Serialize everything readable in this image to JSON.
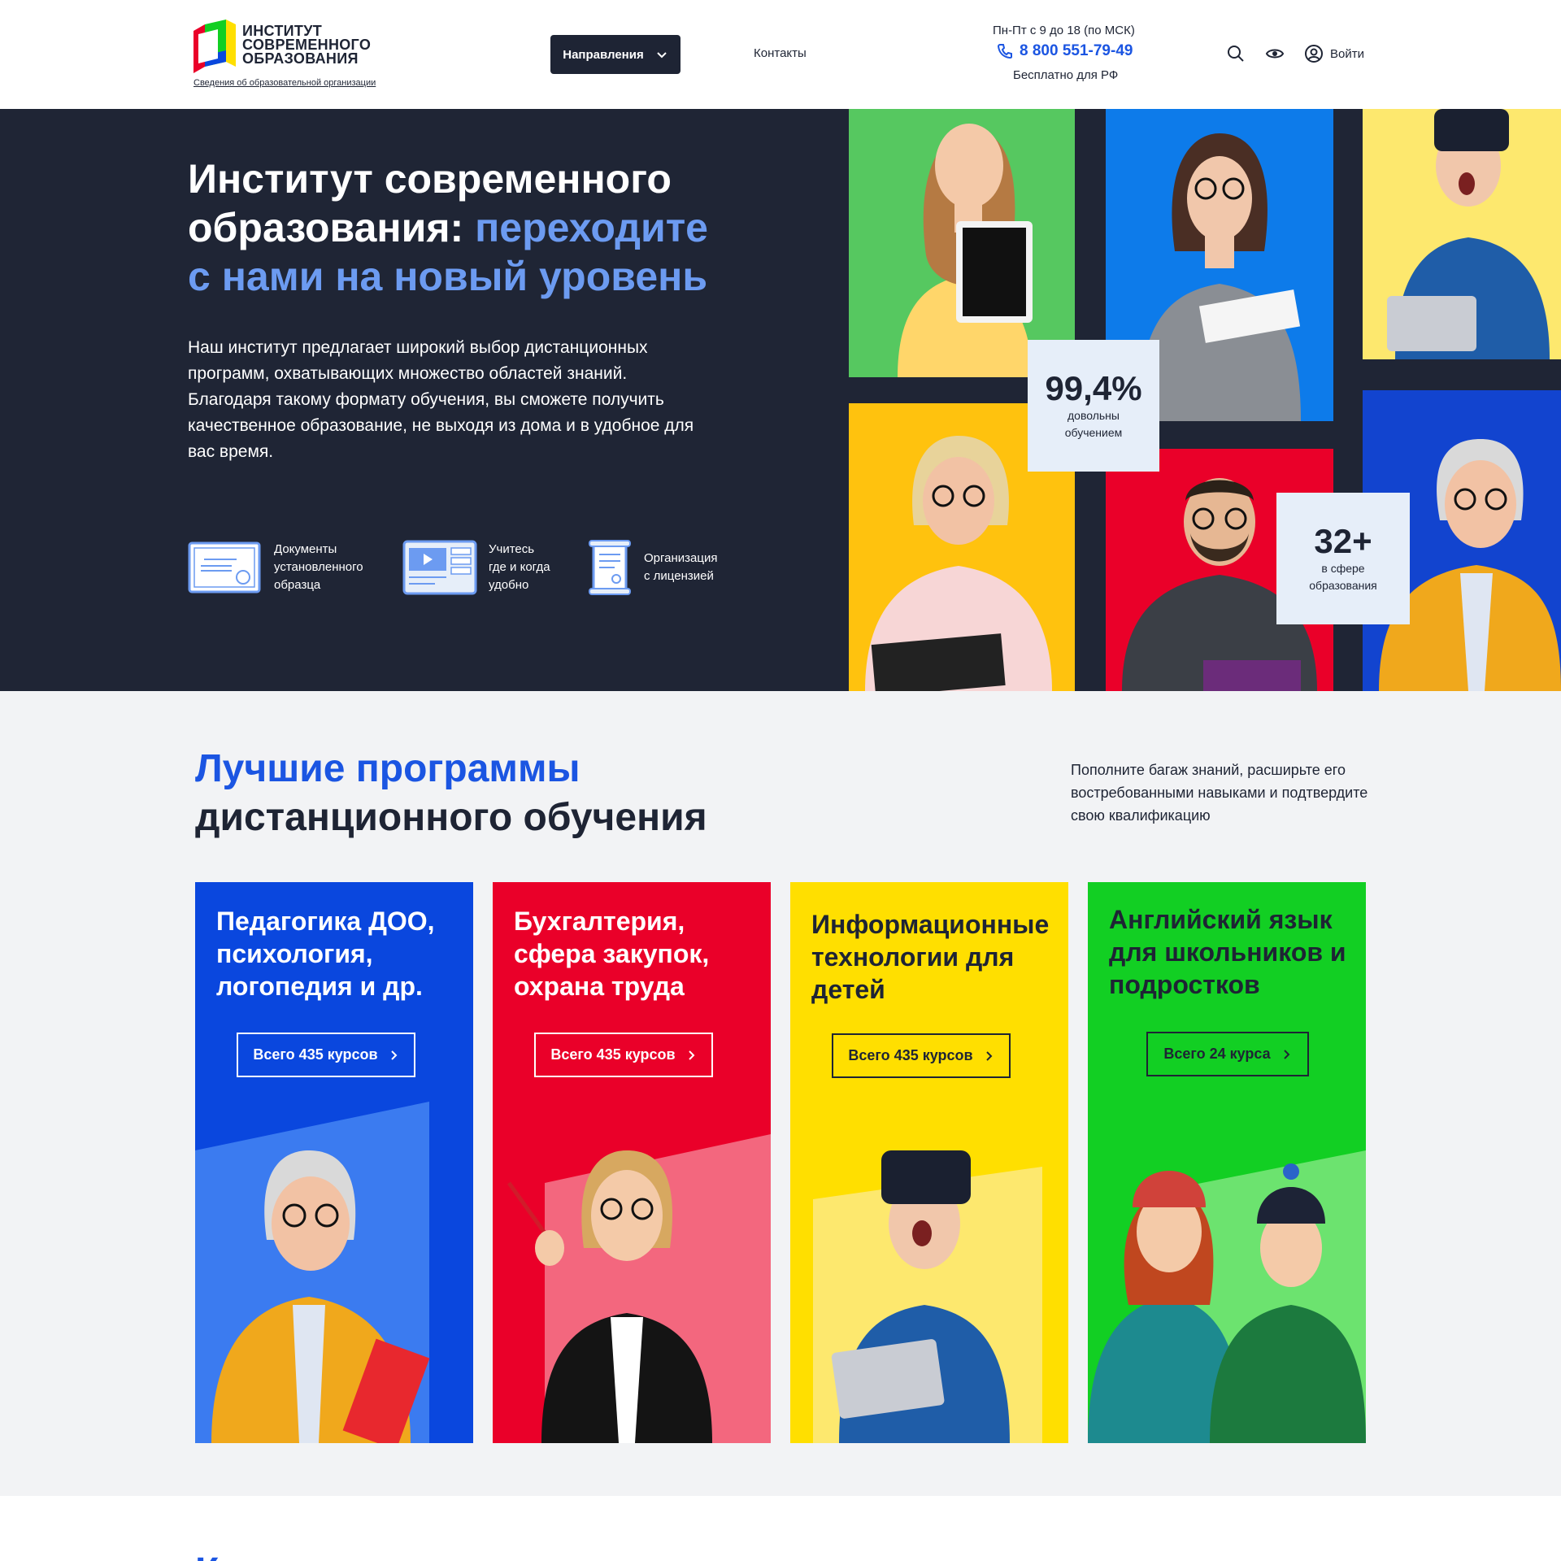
{
  "header": {
    "logo_text": "Институт современного образования",
    "logo_sub": "Сведения об образовательной организации",
    "nav_directions": "Направления",
    "nav_contacts": "Контакты",
    "work_hours": "Пн-Пт с 9 до 18 (по МСК)",
    "phone": "8 800 551-79-49",
    "phone_note": "Бесплатно для РФ",
    "login": "Войти"
  },
  "hero": {
    "title_plain": "Институт современного образования: ",
    "title_accent": "переходите с нами на новый уровень",
    "description": "Наш институт предлагает широкий выбор дистанционных программ, охватывающих множество областей знаний. Благодаря такому формату обучения, вы сможете получить качественное образование, не выходя из дома и в удобное для вас время.",
    "features": [
      {
        "icon": "certificate-icon",
        "line1": "Документы",
        "line2": "установленного",
        "line3": "образца"
      },
      {
        "icon": "video-lesson-icon",
        "line1": "Учитесь",
        "line2": "где и когда",
        "line3": "удобно"
      },
      {
        "icon": "license-scroll-icon",
        "line1": "Организация",
        "line2": "с лицензией",
        "line3": ""
      }
    ],
    "stats": [
      {
        "value": "99,4%",
        "label1": "довольны",
        "label2": "обучением"
      },
      {
        "value": "32+",
        "label1": "в сфере",
        "label2": "образования"
      }
    ]
  },
  "programs": {
    "title_blue": "Лучшие программы",
    "title_dark": "дистанционного обучения",
    "description": "Пополните багаж знаний, расширьте его востребованными навыками и подтвердите свою квалификацию",
    "cards": [
      {
        "title": "Педагогика ДОО, психология, логопедия и др.",
        "button": "Всего 435 курсов",
        "bg": "#0a47de",
        "fg": "#ffffff"
      },
      {
        "title": "Бухгалтерия, сфера закупок, охрана труда",
        "button": "Всего 435 курсов",
        "bg": "#ea0029",
        "fg": "#ffffff"
      },
      {
        "title": "Информационные технологии для детей",
        "button": "Всего 435 курсов",
        "bg": "#ffdf00",
        "fg": "#1e2434"
      },
      {
        "title": "Английский язык для школьников и подростков",
        "button": "Всего 24 курса",
        "bg": "#12cf23",
        "fg": "#1e2434"
      }
    ]
  },
  "colors": {
    "accent_blue": "#1b55e2",
    "hero_bg": "#1f2535",
    "hero_accent": "#6c9bf1"
  }
}
